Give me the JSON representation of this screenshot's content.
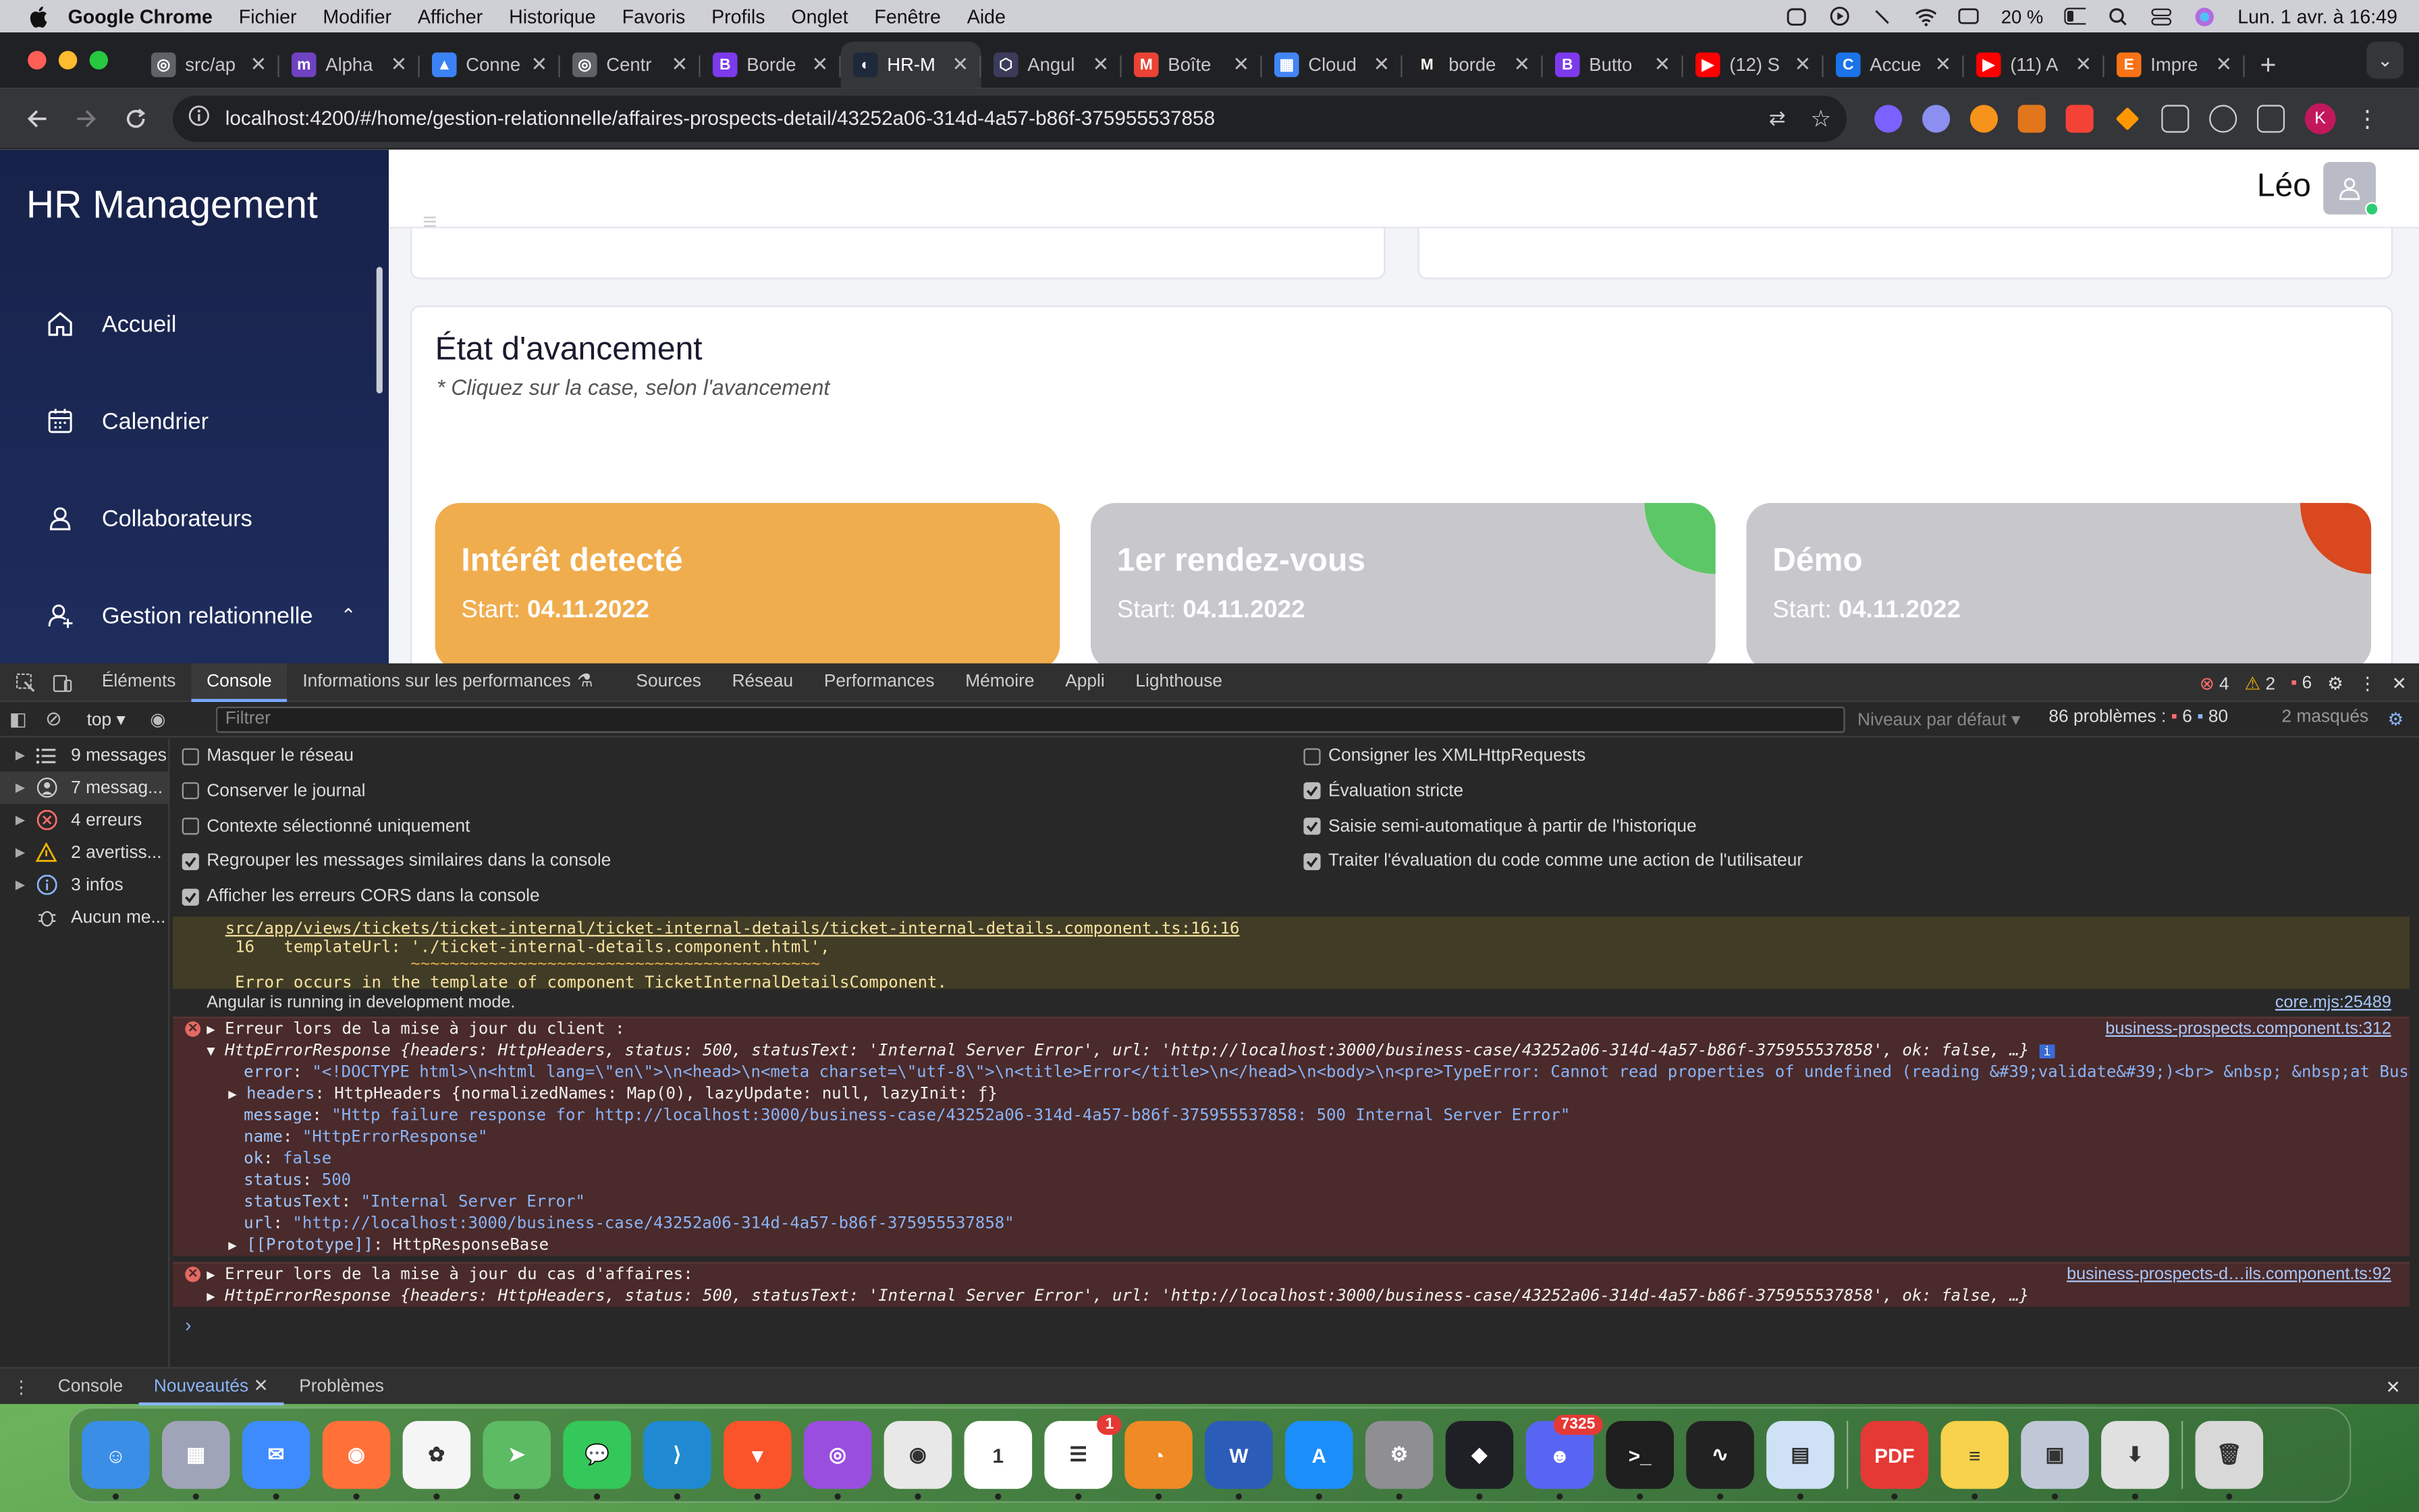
{
  "menubar": {
    "items": [
      "Google Chrome",
      "Fichier",
      "Modifier",
      "Afficher",
      "Historique",
      "Favoris",
      "Profils",
      "Onglet",
      "Fenêtre",
      "Aide"
    ],
    "battery": "20 %",
    "datetime": "Lun. 1 avr. à 16:49"
  },
  "tabs": [
    {
      "title": "src/ap",
      "color": "#5f6368",
      "glyph": "◎"
    },
    {
      "title": "Alpha",
      "color": "#6f42c1",
      "glyph": "m"
    },
    {
      "title": "Conne",
      "color": "#3b82f6",
      "glyph": "▲"
    },
    {
      "title": "Centr",
      "color": "#5f6368",
      "glyph": "◎"
    },
    {
      "title": "Borde",
      "color": "#7c3aed",
      "glyph": "B"
    },
    {
      "title": "HR-M",
      "color": "#1e293b",
      "glyph": "◐",
      "active": true
    },
    {
      "title": "Angul",
      "color": "#3b3b5c",
      "glyph": "⬡"
    },
    {
      "title": "Boîte",
      "color": "#ea4335",
      "glyph": "M"
    },
    {
      "title": "Cloud",
      "color": "#4285f4",
      "glyph": "▦"
    },
    {
      "title": "borde",
      "color": "#222",
      "glyph": "M"
    },
    {
      "title": "Butto",
      "color": "#7c3aed",
      "glyph": "B"
    },
    {
      "title": "(12) S",
      "color": "#ff0000",
      "glyph": "▶"
    },
    {
      "title": "Accue",
      "color": "#1a73e8",
      "glyph": "C"
    },
    {
      "title": "(11) A",
      "color": "#ff0000",
      "glyph": "▶"
    },
    {
      "title": "Impre",
      "color": "#f97316",
      "glyph": "E"
    }
  ],
  "address": "localhost:4200/#/home/gestion-relationnelle/affaires-prospects-detail/43252a06-314d-4a57-b86f-375955537858",
  "profile_initial": "K",
  "app": {
    "brand": "HR Management",
    "nav": [
      "Accueil",
      "Calendrier",
      "Collaborateurs",
      "Gestion relationnelle"
    ],
    "user": "Léo",
    "state_title": "État d'avancement",
    "state_subtitle": "* Cliquez sur la case, selon l'avancement",
    "stages": [
      {
        "name": "Intérêt detecté",
        "start_label": "Start: ",
        "date": "04.11.2022",
        "bg": "#f0ad4e",
        "corner": ""
      },
      {
        "name": "1er rendez-vous",
        "start_label": "Start: ",
        "date": "04.11.2022",
        "bg": "#c8c8cc",
        "corner": "#5cc766"
      },
      {
        "name": "Démo",
        "start_label": "Start: ",
        "date": "04.11.2022",
        "bg": "#c8c8cc",
        "corner": "#d9481f"
      }
    ]
  },
  "devtools": {
    "tabs": [
      "Éléments",
      "Console",
      "Informations sur les performances",
      "Sources",
      "Réseau",
      "Performances",
      "Mémoire",
      "Appli",
      "Lighthouse"
    ],
    "counts": {
      "errors": "4",
      "warnings": "2",
      "messages": "6"
    },
    "context": "top",
    "filter_placeholder": "Filtrer",
    "levels": "Niveaux par défaut",
    "problems": "86 problèmes :",
    "problems_err": "6",
    "problems_info": "80",
    "hidden": "2 masqués",
    "sidebar": [
      {
        "label": "9 messages",
        "icon": "list-icon"
      },
      {
        "label": "7 messag...",
        "icon": "user-icon"
      },
      {
        "label": "4 erreurs",
        "icon": "error-icon"
      },
      {
        "label": "2 avertiss...",
        "icon": "warning-icon"
      },
      {
        "label": "3 infos",
        "icon": "info-icon"
      },
      {
        "label": "Aucun me...",
        "icon": "bug-icon"
      }
    ],
    "settings_left": [
      {
        "label": "Masquer le réseau",
        "checked": false
      },
      {
        "label": "Conserver le journal",
        "checked": false
      },
      {
        "label": "Contexte sélectionné uniquement",
        "checked": false
      },
      {
        "label": "Regrouper les messages similaires dans la console",
        "checked": true
      },
      {
        "label": "Afficher les erreurs CORS dans la console",
        "checked": true
      }
    ],
    "settings_right": [
      {
        "label": "Consigner les XMLHttpRequests",
        "checked": false
      },
      {
        "label": "Évaluation stricte",
        "checked": true
      },
      {
        "label": "Saisie semi-automatique à partir de l'historique",
        "checked": true
      },
      {
        "label": "Traiter l'évaluation du code comme une action de l'utilisateur",
        "checked": true
      }
    ],
    "warn_lines": [
      "src/app/views/tickets/ticket-internal/ticket-internal-details/ticket-internal-details.component.ts:16:16",
      " 16   templateUrl: './ticket-internal-details.component.html',",
      "                   ~~~~~~~~~~~~~~~~~~~~~~~~~~~~~~~~~~~~~~~~~~",
      " Error occurs in the template of component TicketInternalDetailsComponent."
    ],
    "info_line": "Angular is running in development mode.",
    "info_src": "core.mjs:25489",
    "err1_title": "Erreur lors de la mise à jour du client :",
    "err1_src": "business-prospects.component.ts:312",
    "err1_summary": "HttpErrorResponse {headers: HttpHeaders, status: 500, statusText: 'Internal Server Error', url: 'http://localhost:3000/business-case/43252a06-314d-4a57-b86f-375955537858', ok: false, …}",
    "err1_props": [
      {
        "k": "error",
        "v": "\"<!DOCTYPE html>\\n<html lang=\\\"en\\\">\\n<head>\\n<meta charset=\\\"utf-8\\\">\\n<title>Error</title>\\n</head>\\n<body>\\n<pre>TypeError: Cannot read properties of undefined (reading &#39;validate&#39;)<br> &nbsp; &nbsp;at BusinessCaseService."
      },
      {
        "k": "headers",
        "v": "HttpHeaders {normalizedNames: Map(0), lazyUpdate: null, lazyInit: ƒ}",
        "arrow": true
      },
      {
        "k": "message",
        "v": "\"Http failure response for http://localhost:3000/business-case/43252a06-314d-4a57-b86f-375955537858: 500 Internal Server Error\""
      },
      {
        "k": "name",
        "v": "\"HttpErrorResponse\""
      },
      {
        "k": "ok",
        "v": "false"
      },
      {
        "k": "status",
        "v": "500"
      },
      {
        "k": "statusText",
        "v": "\"Internal Server Error\""
      },
      {
        "k": "url",
        "v": "\"http://localhost:3000/business-case/43252a06-314d-4a57-b86f-375955537858\""
      },
      {
        "k": "[[Prototype]]",
        "v": "HttpResponseBase",
        "arrow": true
      }
    ],
    "err2_title": "Erreur lors de la mise à jour du cas d'affaires:",
    "err2_src": "business-prospects-d…ils.component.ts:92",
    "err2_summary": "HttpErrorResponse {headers: HttpHeaders, status: 500, statusText: 'Internal Server Error', url: 'http://localhost:3000/business-case/43252a06-314d-4a57-b86f-375955537858', ok: false, …}",
    "drawer_tabs": [
      "Console",
      "Nouveautés",
      "Problèmes"
    ]
  },
  "dock": {
    "apps": [
      {
        "name": "finder",
        "color": "#3a8ee6",
        "glyph": "☺"
      },
      {
        "name": "launchpad",
        "color": "#a0a4b8",
        "glyph": "▦"
      },
      {
        "name": "mail",
        "color": "#3d8bfd",
        "glyph": "✉"
      },
      {
        "name": "firefox",
        "color": "#ff7139",
        "glyph": "◉"
      },
      {
        "name": "photos",
        "color": "#f5f5f5",
        "glyph": "✿"
      },
      {
        "name": "maps",
        "color": "#5dbb63",
        "glyph": "➤"
      },
      {
        "name": "messages",
        "color": "#34c759",
        "glyph": "💬"
      },
      {
        "name": "vscode",
        "color": "#1f8ad2",
        "glyph": "⟩"
      },
      {
        "name": "brave",
        "color": "#fb542b",
        "glyph": "▼"
      },
      {
        "name": "podcasts",
        "color": "#9a4ee0",
        "glyph": "◎"
      },
      {
        "name": "chrome",
        "color": "#e8e8e8",
        "glyph": "◉"
      },
      {
        "name": "calendar",
        "color": "#ffffff",
        "glyph": "1"
      },
      {
        "name": "reminders",
        "color": "#ffffff",
        "glyph": "☰",
        "badge": "1"
      },
      {
        "name": "blender",
        "color": "#f08a24",
        "glyph": "◔"
      },
      {
        "name": "word",
        "color": "#2b5cb8",
        "glyph": "W"
      },
      {
        "name": "app-store",
        "color": "#1c8ef9",
        "glyph": "A"
      },
      {
        "name": "system-settings",
        "color": "#8e8e93",
        "glyph": "⚙"
      },
      {
        "name": "binance",
        "color": "#1e2026",
        "glyph": "◆"
      },
      {
        "name": "discord",
        "color": "#5865f2",
        "glyph": "☻",
        "badge": "7325"
      },
      {
        "name": "terminal",
        "color": "#1e1e1e",
        "glyph": ">_"
      },
      {
        "name": "activity-monitor",
        "color": "#222",
        "glyph": "∿"
      },
      {
        "name": "preview",
        "color": "#cfe1f5",
        "glyph": "▤"
      },
      {
        "name": "sep",
        "color": "",
        "glyph": ""
      },
      {
        "name": "pdf",
        "color": "#e53935",
        "glyph": "PDF"
      },
      {
        "name": "notes",
        "color": "#f7d24a",
        "glyph": "≡"
      },
      {
        "name": "image-viewer",
        "color": "#c0c8d8",
        "glyph": "▣"
      },
      {
        "name": "installer",
        "color": "#e0e0e0",
        "glyph": "⬇"
      },
      {
        "name": "sep",
        "color": "",
        "glyph": ""
      },
      {
        "name": "trash",
        "color": "#d8d8d8",
        "glyph": "🗑"
      }
    ]
  }
}
